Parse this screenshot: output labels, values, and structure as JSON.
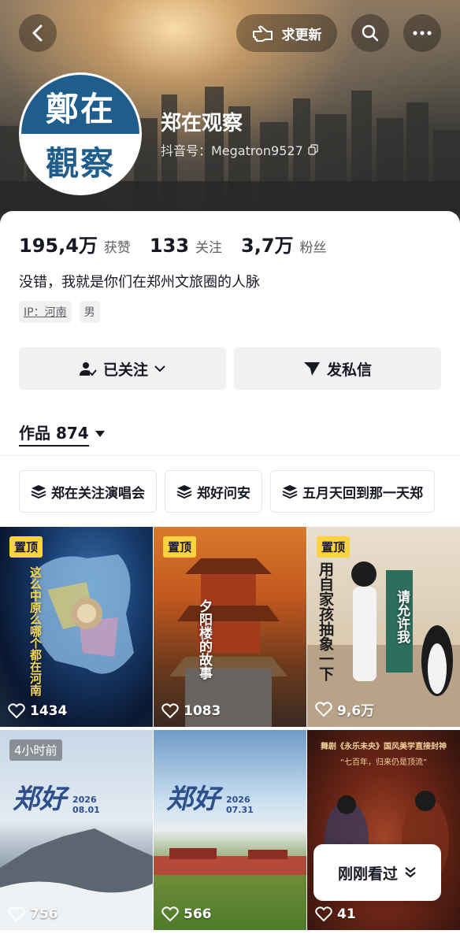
{
  "header": {
    "update_label": "求更新",
    "icons": {
      "back": "back-arrow-icon",
      "update": "hand-point-icon",
      "search": "search-icon",
      "more": "more-dots-icon"
    }
  },
  "profile": {
    "avatar_line1": "鄭在",
    "avatar_line2": "觀察",
    "nickname": "郑在观察",
    "douyin_id": "抖音号：Megatron9527",
    "stats": [
      {
        "num": "195,4万",
        "label": "获赞"
      },
      {
        "num": "133",
        "label": "关注"
      },
      {
        "num": "3,7万",
        "label": "粉丝"
      }
    ],
    "bio": "没错，我就是你们在郑州文旅圈的人脉",
    "tags": [
      "IP：河南",
      "男"
    ],
    "follow_label": "已关注",
    "dm_label": "发私信"
  },
  "works_tab": {
    "label": "作品 874"
  },
  "collections": [
    "郑在关注演唱会",
    "郑好问安",
    "五月天回到那一天郑"
  ],
  "videos": [
    {
      "badge": "置顶",
      "likes": "1434",
      "overlay": "这么中原么哪个都在河南"
    },
    {
      "badge": "置顶",
      "likes": "1083",
      "overlay": "夕阳楼的故事"
    },
    {
      "badge": "置顶",
      "likes": "9,6万",
      "overlay": "用自家孩抽象一下",
      "overlay2": "请允许我"
    },
    {
      "badge": "4小时前",
      "likes": "756",
      "overlay": "郑好",
      "date": "2026 08.01"
    },
    {
      "badge": "",
      "likes": "566",
      "overlay": "郑好",
      "date": "2026 07.31"
    },
    {
      "badge": "",
      "likes": "41",
      "overlay": "舞剧《永乐未央》国风美学直接封神",
      "overlay2": "“七百年，归来仍是顶流”"
    }
  ],
  "recent_label": "刚刚看过"
}
